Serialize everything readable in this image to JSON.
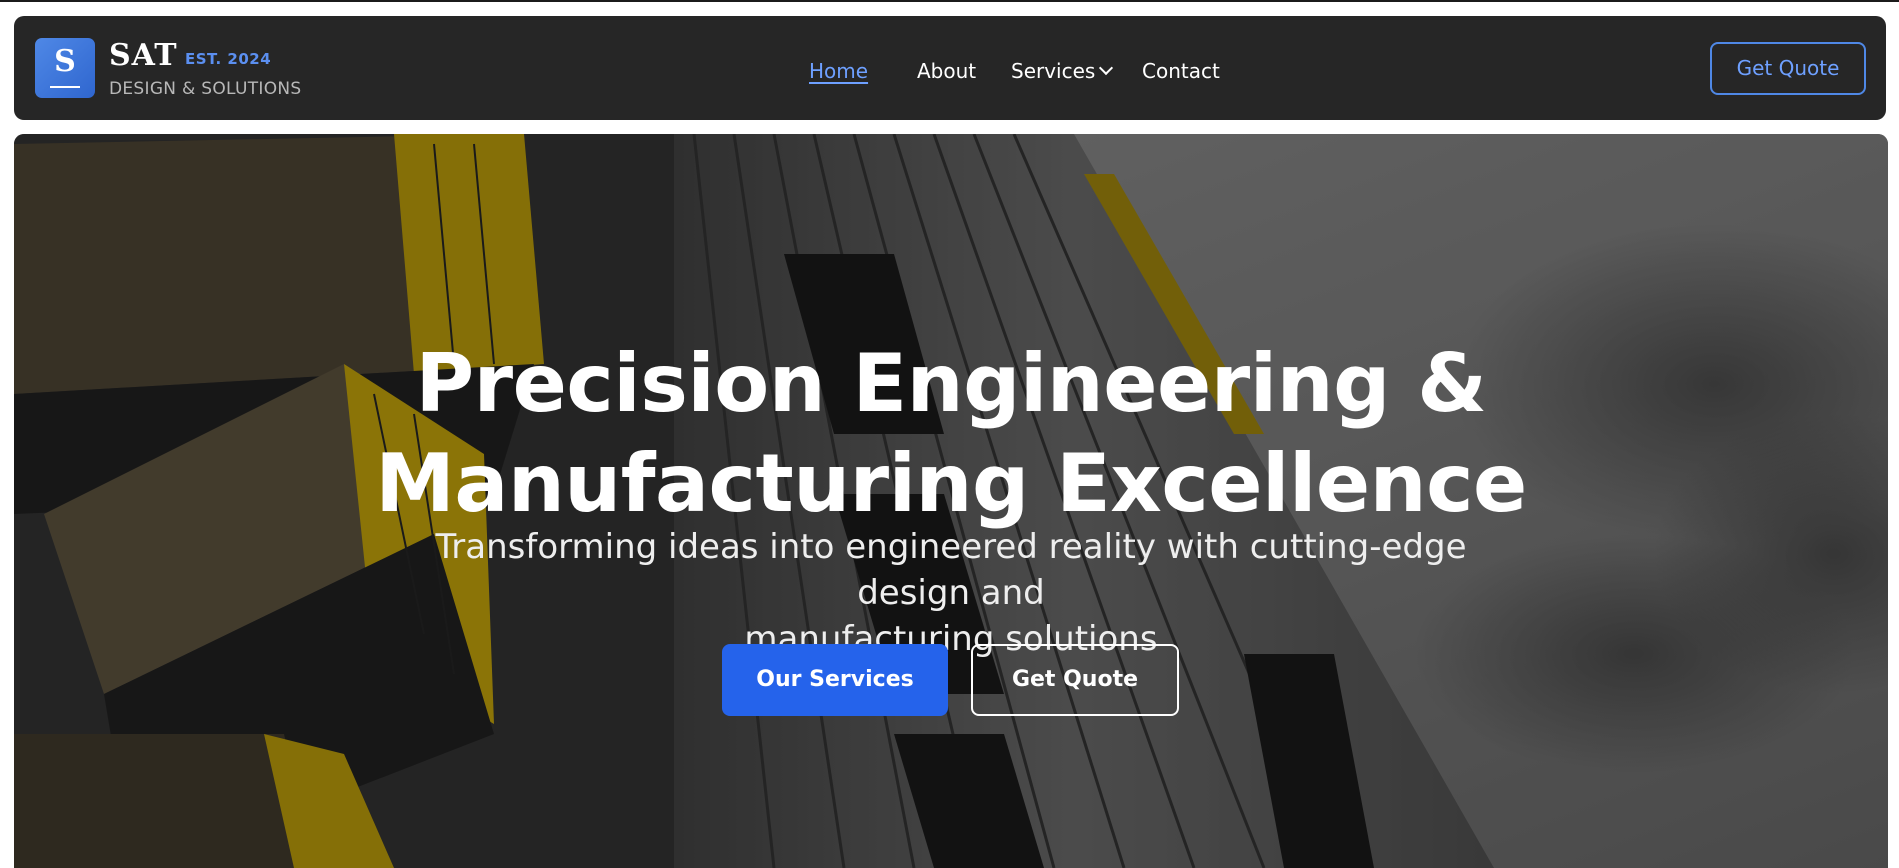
{
  "brand": {
    "logo_letter": "S",
    "name": "SAT",
    "est": "EST. 2024",
    "tagline": "DESIGN & SOLUTIONS",
    "accent_color": "#4f88e6"
  },
  "nav": {
    "items": [
      {
        "label": "Home",
        "active": true
      },
      {
        "label": "About",
        "active": false
      },
      {
        "label": "Services",
        "active": false,
        "has_dropdown": true
      },
      {
        "label": "Contact",
        "active": false
      }
    ],
    "quote_button": "Get Quote"
  },
  "hero": {
    "title_line1": "Precision Engineering &",
    "title_line2": "Manufacturing Excellence",
    "subtitle_line1": "Transforming ideas into engineered reality with cutting-edge design and",
    "subtitle_line2": "manufacturing solutions",
    "primary_button": "Our Services",
    "secondary_button": "Get Quote",
    "primary_color": "#2563eb",
    "background": "building facade with yellow balcony panels against a cloudy sky"
  }
}
